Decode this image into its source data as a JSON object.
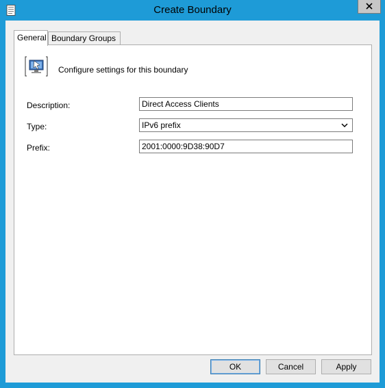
{
  "window": {
    "title": "Create Boundary",
    "title_icon": "document-icon",
    "close_icon": "close-icon"
  },
  "tabs": [
    {
      "label": "General",
      "active": true
    },
    {
      "label": "Boundary Groups",
      "active": false
    }
  ],
  "header": {
    "icon": "boundary-icon",
    "text": "Configure settings for this boundary"
  },
  "form": {
    "description": {
      "label": "Description:",
      "value": "Direct Access Clients"
    },
    "type": {
      "label": "Type:",
      "value": "IPv6 prefix"
    },
    "prefix": {
      "label": "Prefix:",
      "value": "2001:0000:9D38:90D7"
    }
  },
  "buttons": {
    "ok": "OK",
    "cancel": "Cancel",
    "apply": "Apply"
  },
  "colors": {
    "frame": "#1e9bd7",
    "client": "#f0f0f0",
    "panel": "#ffffff"
  }
}
